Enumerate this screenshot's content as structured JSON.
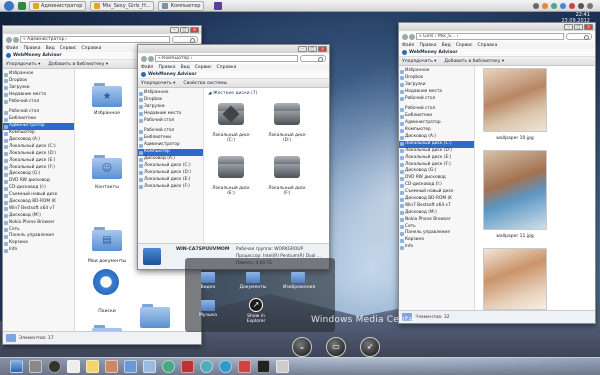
{
  "taskbar": {
    "tasks": [
      "Администратор",
      "Mix_Sexy_Girls_H...",
      "Компьютер"
    ]
  },
  "clock": {
    "time": "22:41",
    "date": "23.09.2012"
  },
  "menu": [
    "Файл",
    "Правка",
    "Вид",
    "Сервис",
    "Справка"
  ],
  "brand": "WebMoney Advisor",
  "windows": {
    "left": {
      "address": "« Администратор ›",
      "cmd": [
        "Упорядочить ▾",
        "Добавить в библиотеку ▾"
      ],
      "nav": [
        {
          "label": "Избранное"
        },
        {
          "label": "Dropbox"
        },
        {
          "label": "Загрузки"
        },
        {
          "label": "Недавние места"
        },
        {
          "label": "Рабочий стол"
        },
        {
          "label": ""
        },
        {
          "label": "Рабочий стол"
        },
        {
          "label": "Библиотеки"
        },
        {
          "label": "Администратор",
          "selected": true
        },
        {
          "label": "Компьютер"
        },
        {
          "label": "Дисковод (A:)"
        },
        {
          "label": "Локальный диск (C:)"
        },
        {
          "label": "Локальный диск (D:)"
        },
        {
          "label": "Локальный диск (E:)"
        },
        {
          "label": "Локальный диск (F:)"
        },
        {
          "label": "Дисковод (G:)"
        },
        {
          "label": "DVD RW дисковод"
        },
        {
          "label": "CD-дисковод (I:)"
        },
        {
          "label": "Съемный новый диск"
        },
        {
          "label": "Дисковод BD-ROM (K"
        },
        {
          "label": "Win7 Bestsoft x64 v7"
        },
        {
          "label": "Дисковод (M:)"
        },
        {
          "label": "Nokia Phone Browser"
        },
        {
          "label": "Сеть"
        },
        {
          "label": "Панель управления"
        },
        {
          "label": "Корзина"
        },
        {
          "label": "Info"
        }
      ],
      "folders": [
        "Избранное",
        "Контакты",
        "Мои документы",
        "Поиски"
      ],
      "status": "Элементов: 17"
    },
    "middle": {
      "address": "« Компьютер ›",
      "cmd": [
        "Упорядочить ▾",
        "Свойства системы"
      ],
      "nav": [
        {
          "label": "Избранное"
        },
        {
          "label": "Dropbox"
        },
        {
          "label": "Загрузки"
        },
        {
          "label": "Недавние места"
        },
        {
          "label": "Рабочий стол"
        },
        {
          "label": ""
        },
        {
          "label": "Рабочий стол"
        },
        {
          "label": "Библиотеки"
        },
        {
          "label": "Администратор"
        },
        {
          "label": "Компьютер",
          "selected": true
        },
        {
          "label": "Дисковод (A:)"
        },
        {
          "label": "Локальный диск (C:)"
        },
        {
          "label": "Локальный диск (D:)"
        },
        {
          "label": "Локальный диск (E:)"
        },
        {
          "label": "Локальный диск (F:)"
        }
      ],
      "section": "◢ Жесткие диски (7)",
      "drives": [
        "Локальный диск (C:)",
        "Локальный диск (D:)",
        "Локальный диск (E:)",
        "Локальный диск (F:)"
      ],
      "details": {
        "name": "WIN-CA7SPUUVMOM",
        "workgroup": "Рабочая группа: WORKGROUP",
        "cpu": "Процессор: Intel(R) Pentium(R) Dual ...",
        "memory": "Память: 4,00 ГБ"
      }
    },
    "right": {
      "address": "« Girls › Mix_S... ›",
      "cmd": [
        "Упорядочить ▾",
        "Добавить в библиотеку ▾"
      ],
      "nav": [
        {
          "label": "Избранное"
        },
        {
          "label": "Dropbox"
        },
        {
          "label": "Загрузки"
        },
        {
          "label": "Недавние места"
        },
        {
          "label": "Рабочий стол"
        },
        {
          "label": ""
        },
        {
          "label": "Рабочий стол"
        },
        {
          "label": "Библиотеки"
        },
        {
          "label": "Администратор"
        },
        {
          "label": "Компьютер"
        },
        {
          "label": "Дисковод (A:)"
        },
        {
          "label": "Локальный диск (C:)",
          "selected": true
        },
        {
          "label": "Локальный диск (D:)"
        },
        {
          "label": "Локальный диск (E:)"
        },
        {
          "label": "Локальный диск (F:)"
        },
        {
          "label": "Дисковод (G:)"
        },
        {
          "label": "DVD RW дисковод"
        },
        {
          "label": "CD-дисковод (I:)"
        },
        {
          "label": "Съемный новый диск"
        },
        {
          "label": "Дисковод BD-ROM (K"
        },
        {
          "label": "Win7 Bestsoft x64 v7"
        },
        {
          "label": "Дисковод (M:)"
        },
        {
          "label": "Nokia Phone Browser"
        },
        {
          "label": "Сеть"
        },
        {
          "label": "Панель управления"
        },
        {
          "label": "Корзина"
        },
        {
          "label": "Info"
        }
      ],
      "thumbs": [
        "wallpaper 10.jpg",
        "wallpaper 11.jpg",
        ""
      ],
      "status": "Элементов: 32"
    }
  },
  "wmc": {
    "items": [
      "Видео",
      "Документы",
      "Изображения",
      "Музыка",
      "Show in Explorer"
    ],
    "logo": "Windows Media Center"
  },
  "colors": {
    "selection": "#2d6bc8",
    "folder": "#5b8fd0"
  }
}
